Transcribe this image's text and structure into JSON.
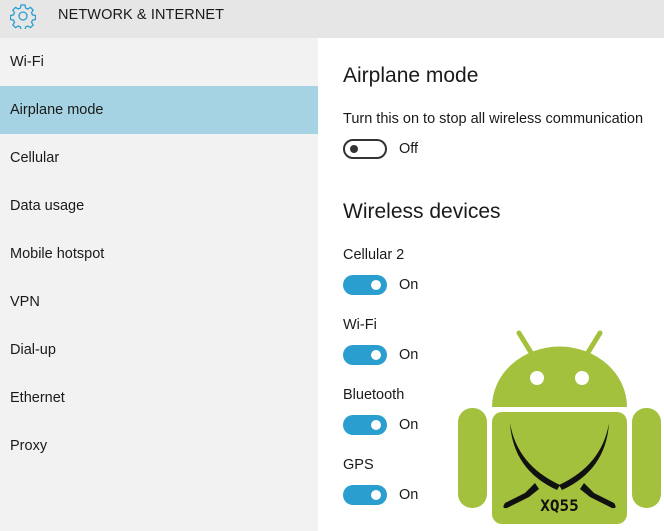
{
  "header": {
    "icon": "gear-icon",
    "title": "NETWORK & INTERNET"
  },
  "sidebar": {
    "selected_index": 1,
    "items": [
      {
        "label": "Wi-Fi"
      },
      {
        "label": "Airplane mode"
      },
      {
        "label": "Cellular"
      },
      {
        "label": "Data usage"
      },
      {
        "label": "Mobile hotspot"
      },
      {
        "label": "VPN"
      },
      {
        "label": "Dial-up"
      },
      {
        "label": "Ethernet"
      },
      {
        "label": "Proxy"
      }
    ]
  },
  "main": {
    "airplane": {
      "heading": "Airplane mode",
      "description": "Turn this on to stop all wireless communication",
      "toggle_state": "Off"
    },
    "wireless": {
      "heading": "Wireless devices",
      "devices": [
        {
          "label": "Cellular 2",
          "state": "On"
        },
        {
          "label": "Wi-Fi",
          "state": "On"
        },
        {
          "label": "Bluetooth",
          "state": "On"
        },
        {
          "label": "GPS",
          "state": "On"
        }
      ]
    }
  },
  "overlay_logo": {
    "icon": "android-crossed-swords-logo",
    "text": "XQ55"
  },
  "colors": {
    "accent": "#2a9fcf",
    "selected_bg": "#a6d3e3",
    "android_green": "#a4c13d"
  }
}
